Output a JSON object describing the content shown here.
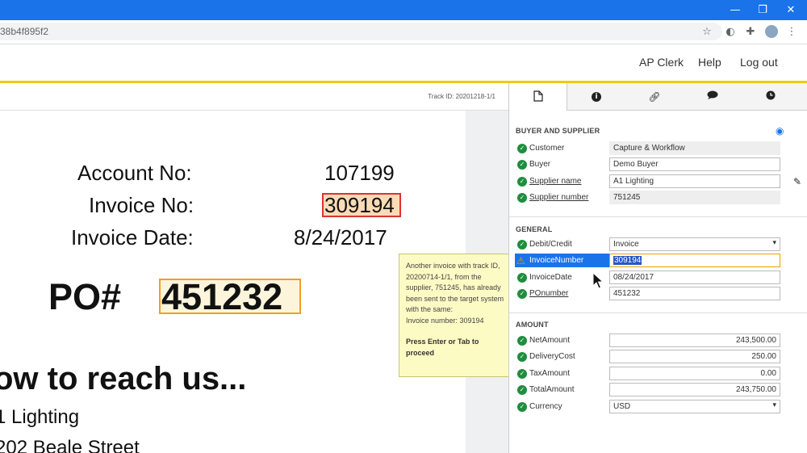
{
  "browser": {
    "url_fragment": "38b4f895f2"
  },
  "header": {
    "links": [
      "AP Clerk",
      "Help",
      "Log out"
    ]
  },
  "document": {
    "track_id": "Track ID: 20201218-1/1",
    "account_label": "Account No:",
    "account_value": "107199",
    "invoice_no_label": "Invoice No:",
    "invoice_no_value": "309194",
    "invoice_date_label": "Invoice Date:",
    "invoice_date_value": "8/24/2017",
    "po_label": "PO#",
    "po_value": "451232",
    "reach_heading": "ow to reach us...",
    "address_line1": "1 Lighting",
    "address_line2": "202 Beale Street"
  },
  "tooltip": {
    "message": "Another invoice with track ID, 20200714-1/1, from the supplier, 751245, has already been sent to the target system with the same:",
    "detail": "Invoice number: 309194",
    "hint": "Press Enter or Tab to proceed"
  },
  "panel": {
    "tabs": [
      "document-icon",
      "info-icon",
      "link-icon",
      "comment-icon",
      "clock-icon"
    ],
    "buyer_supplier": {
      "title": "BUYER AND SUPPLIER",
      "fields": [
        {
          "label": "Customer",
          "value": "Capture & Workflow"
        },
        {
          "label": "Buyer",
          "value": "Demo Buyer"
        },
        {
          "label": "Supplier name",
          "value": "A1 Lighting"
        },
        {
          "label": "Supplier number",
          "value": "751245"
        }
      ]
    },
    "general": {
      "title": "GENERAL",
      "fields": [
        {
          "label": "Debit/Credit",
          "value": "Invoice"
        },
        {
          "label": "InvoiceNumber",
          "value": "309194"
        },
        {
          "label": "InvoiceDate",
          "value": "08/24/2017"
        },
        {
          "label": "POnumber",
          "value": "451232"
        }
      ]
    },
    "amount": {
      "title": "AMOUNT",
      "fields": [
        {
          "label": "NetAmount",
          "value": "243,500.00"
        },
        {
          "label": "DeliveryCost",
          "value": "250.00"
        },
        {
          "label": "TaxAmount",
          "value": "0.00"
        },
        {
          "label": "TotalAmount",
          "value": "243,750.00"
        },
        {
          "label": "Currency",
          "value": "USD"
        }
      ]
    }
  },
  "colors": {
    "titlebar": "#1a73e8",
    "accent_yellow": "#f2c811",
    "check_green": "#1e8e3e",
    "warning": "#e8a000"
  }
}
